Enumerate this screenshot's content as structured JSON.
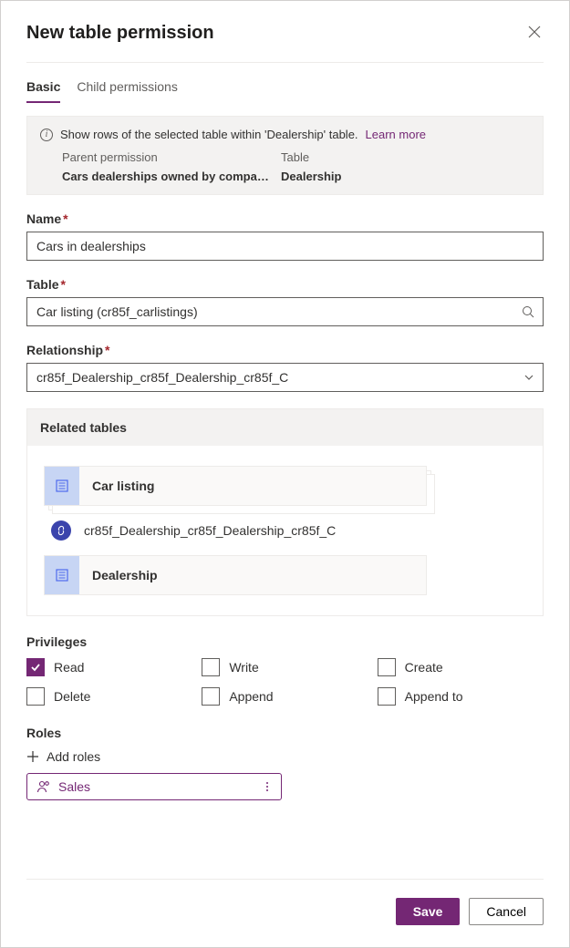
{
  "header": {
    "title": "New table permission"
  },
  "tabs": {
    "basic": "Basic",
    "child": "Child permissions"
  },
  "info": {
    "text": "Show rows of the selected table within 'Dealership' table.",
    "learn_more": "Learn more",
    "parent_permission_label": "Parent permission",
    "table_label": "Table",
    "parent_permission_value": "Cars dealerships owned by compa…",
    "table_value": "Dealership"
  },
  "fields": {
    "name": {
      "label": "Name",
      "value": "Cars in dealerships"
    },
    "table": {
      "label": "Table",
      "value": "Car listing (cr85f_carlistings)"
    },
    "relationship": {
      "label": "Relationship",
      "value": "cr85f_Dealership_cr85f_Dealership_cr85f_C"
    }
  },
  "related": {
    "header": "Related tables",
    "card1": "Car listing",
    "link_text": "cr85f_Dealership_cr85f_Dealership_cr85f_C",
    "card2": "Dealership"
  },
  "privileges": {
    "header": "Privileges",
    "read": "Read",
    "write": "Write",
    "create": "Create",
    "delete": "Delete",
    "append": "Append",
    "append_to": "Append to"
  },
  "roles": {
    "header": "Roles",
    "add": "Add roles",
    "chip": "Sales"
  },
  "footer": {
    "save": "Save",
    "cancel": "Cancel"
  }
}
